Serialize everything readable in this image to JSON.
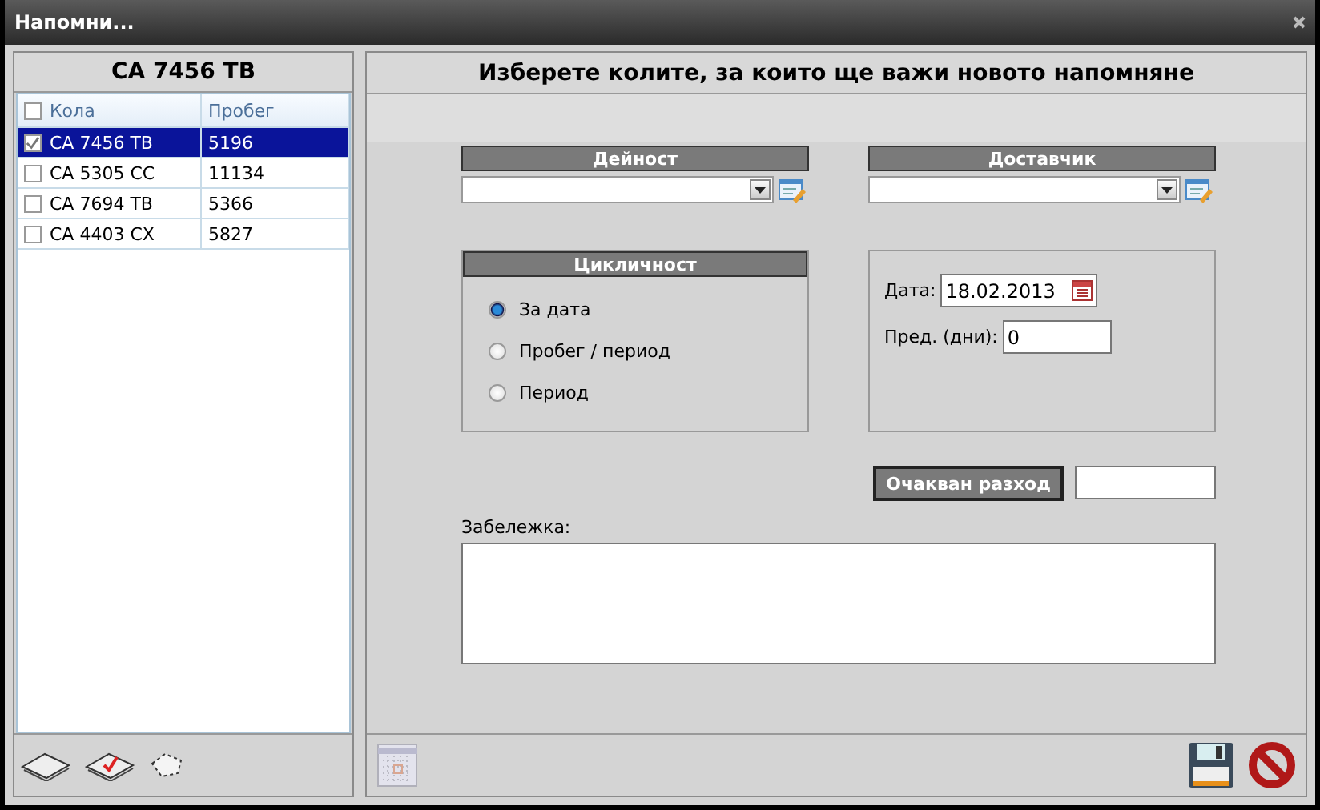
{
  "window": {
    "title": "Напомни..."
  },
  "left_panel": {
    "title": "CA 7456 TB",
    "columns": [
      "Кола",
      "Пробег"
    ],
    "header_checked": false,
    "rows": [
      {
        "car": "CA 7456 TB",
        "mileage": "5196",
        "checked": true,
        "selected": true
      },
      {
        "car": "CA 5305 CC",
        "mileage": "11134",
        "checked": false,
        "selected": false
      },
      {
        "car": "CA 7694 TB",
        "mileage": "5366",
        "checked": false,
        "selected": false
      },
      {
        "car": "CA 4403 CX",
        "mileage": "5827",
        "checked": false,
        "selected": false
      }
    ]
  },
  "form": {
    "title": "Изберете колите, за които ще важи новото напомняне",
    "activity": {
      "label": "Дейност"
    },
    "supplier": {
      "label": "Доставчик"
    },
    "cycle": {
      "label": "Цикличност",
      "options": [
        {
          "label": "За дата",
          "selected": true
        },
        {
          "label": "Пробег / период",
          "selected": false
        },
        {
          "label": "Период",
          "selected": false
        }
      ]
    },
    "date": {
      "label": "Дата:",
      "value": "18.02.2013"
    },
    "days": {
      "label": "Пред. (дни):",
      "value": "0"
    },
    "expense": {
      "label": "Очакван разход"
    },
    "note": {
      "label": "Забележка:"
    }
  }
}
